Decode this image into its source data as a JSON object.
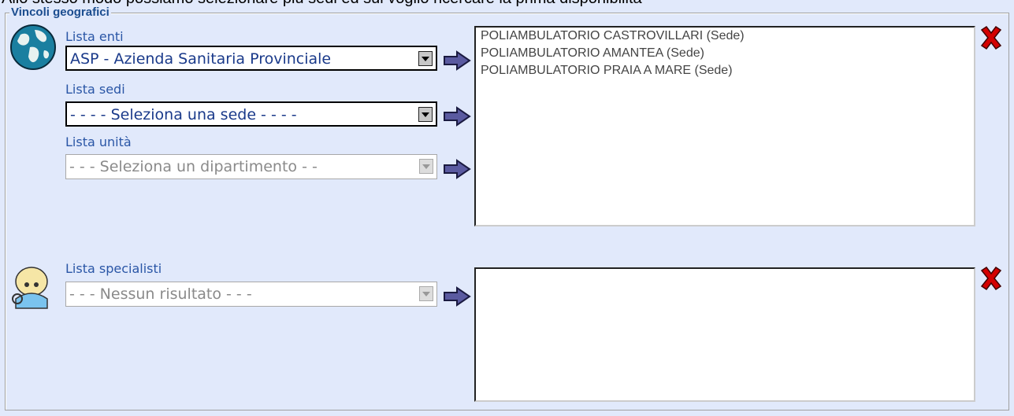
{
  "intro_text": "Allo stesso modo possiamo selezionare più sedi ed sui voglio ricercare la prima disponibilità",
  "fieldset": {
    "legend": "Vincoli geografici"
  },
  "enti": {
    "label": "Lista enti",
    "value": "ASP - Azienda Sanitaria Provinciale"
  },
  "sedi": {
    "label": "Lista sedi",
    "value": "- - - -  Seleziona una sede  - - - -"
  },
  "unita": {
    "label": "Lista unità",
    "value": "- - -  Seleziona un dipartimento  - -"
  },
  "selected_sedi": [
    "POLIAMBULATORIO CASTROVILLARI (Sede)",
    "POLIAMBULATORIO AMANTEA (Sede)",
    "POLIAMBULATORIO PRAIA A MARE (Sede)"
  ],
  "specialisti": {
    "label": "Lista specialisti",
    "value": "- - -  Nessun risultato  - - -"
  },
  "colors": {
    "background": "#e1e9fb",
    "label": "#2a56a6",
    "arrow": "#5a5aa0",
    "remove": "#cc0000"
  },
  "icons": [
    "globe-icon",
    "doctor-icon",
    "arrow-right-icon",
    "remove-x-icon"
  ]
}
